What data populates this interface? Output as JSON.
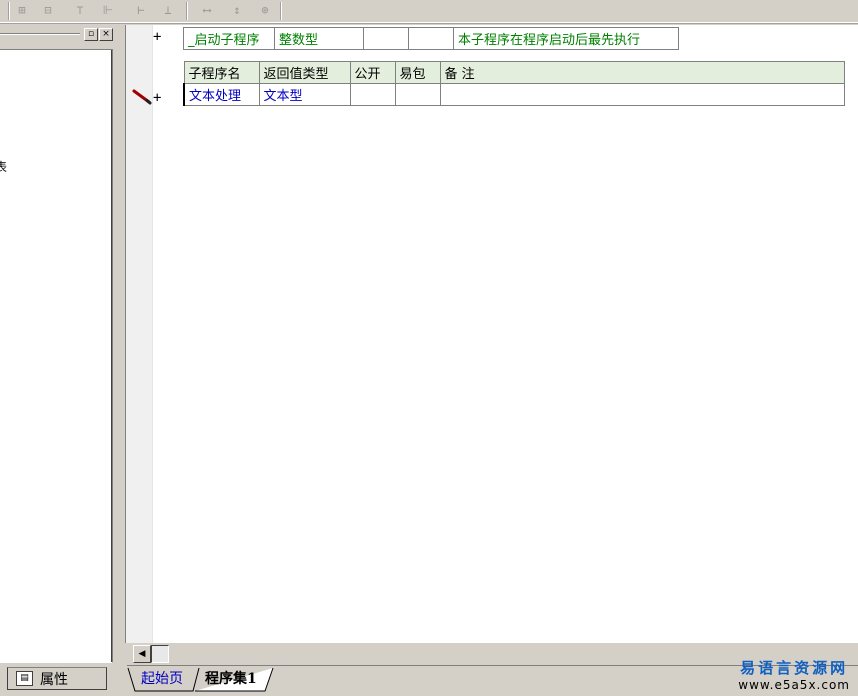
{
  "toolbar": {
    "icons": [
      "align-left-icon",
      "align-center-icon",
      "align-top-icon",
      "align-middle-icon",
      "same-width-icon",
      "same-height-icon",
      "space-horizontal-icon",
      "space-vertical-icon",
      "center-both-icon"
    ]
  },
  "left_panel": {
    "clipped_text": "表",
    "property_tab_label": "属性"
  },
  "code": {
    "startup_sub": {
      "name": "_启动子程序",
      "return_type": "整数型",
      "public": "",
      "easy_pack": "",
      "remark": "本子程序在程序启动后最先执行"
    },
    "table_headers": [
      "子程序名",
      "返回值类型",
      "公开",
      "易包",
      "备 注"
    ],
    "sub_row": {
      "name": "文本处理",
      "return_type": "文本型",
      "public": "",
      "easy_pack": "",
      "remark": ""
    },
    "expand_symbol": "+"
  },
  "tabs": {
    "start_page": "起始页",
    "program_set": "程序集1"
  },
  "watermark": {
    "site_name": "易语言资源网",
    "url": "www.e5a5x.com"
  },
  "colors": {
    "keyword_green": "#008000",
    "type_blue": "#0000c0",
    "header_bg": "#e4eedc"
  }
}
